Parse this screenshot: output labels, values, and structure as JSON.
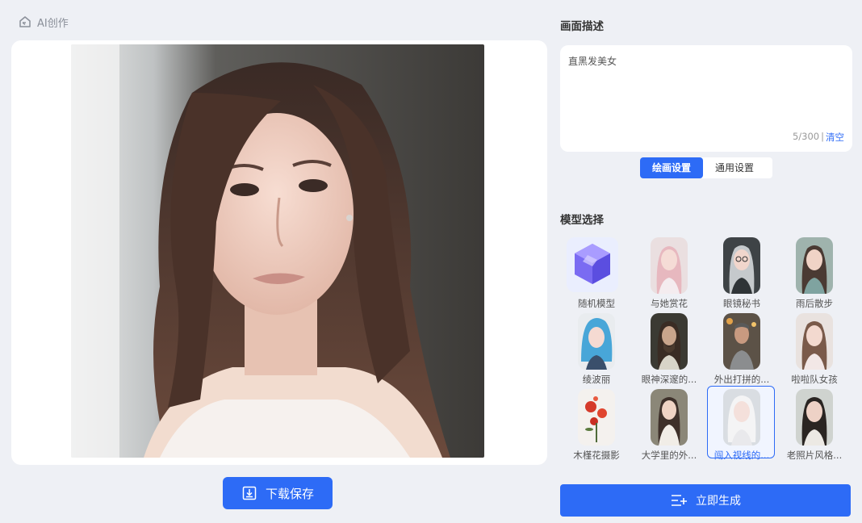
{
  "breadcrumb": {
    "label": "AI创作",
    "icon": "home-icon"
  },
  "preview": {
    "download_label": "下载保存"
  },
  "description": {
    "title": "画面描述",
    "prompt": "直黑发美女",
    "count": "5/300",
    "separator": "|",
    "clear_label": "清空"
  },
  "settings_tabs": [
    {
      "label": "绘画设置",
      "active": true
    },
    {
      "label": "通用设置",
      "active": false
    }
  ],
  "models": {
    "title": "模型选择",
    "items": [
      {
        "label": "随机模型",
        "selected": false
      },
      {
        "label": "与她赏花",
        "selected": false
      },
      {
        "label": "眼镜秘书",
        "selected": false
      },
      {
        "label": "雨后散步",
        "selected": false
      },
      {
        "label": "绫波丽",
        "selected": false
      },
      {
        "label": "眼神深邃的...",
        "selected": false
      },
      {
        "label": "外出打拼的...",
        "selected": false
      },
      {
        "label": "啦啦队女孩",
        "selected": false
      },
      {
        "label": "木槿花摄影",
        "selected": false
      },
      {
        "label": "大学里的外...",
        "selected": false
      },
      {
        "label": "闯入视线的...",
        "selected": true
      },
      {
        "label": "老照片风格...",
        "selected": false
      }
    ]
  },
  "generate": {
    "label": "立即生成"
  },
  "colors": {
    "accent": "#2d6bf6",
    "background": "#eef0f5"
  }
}
